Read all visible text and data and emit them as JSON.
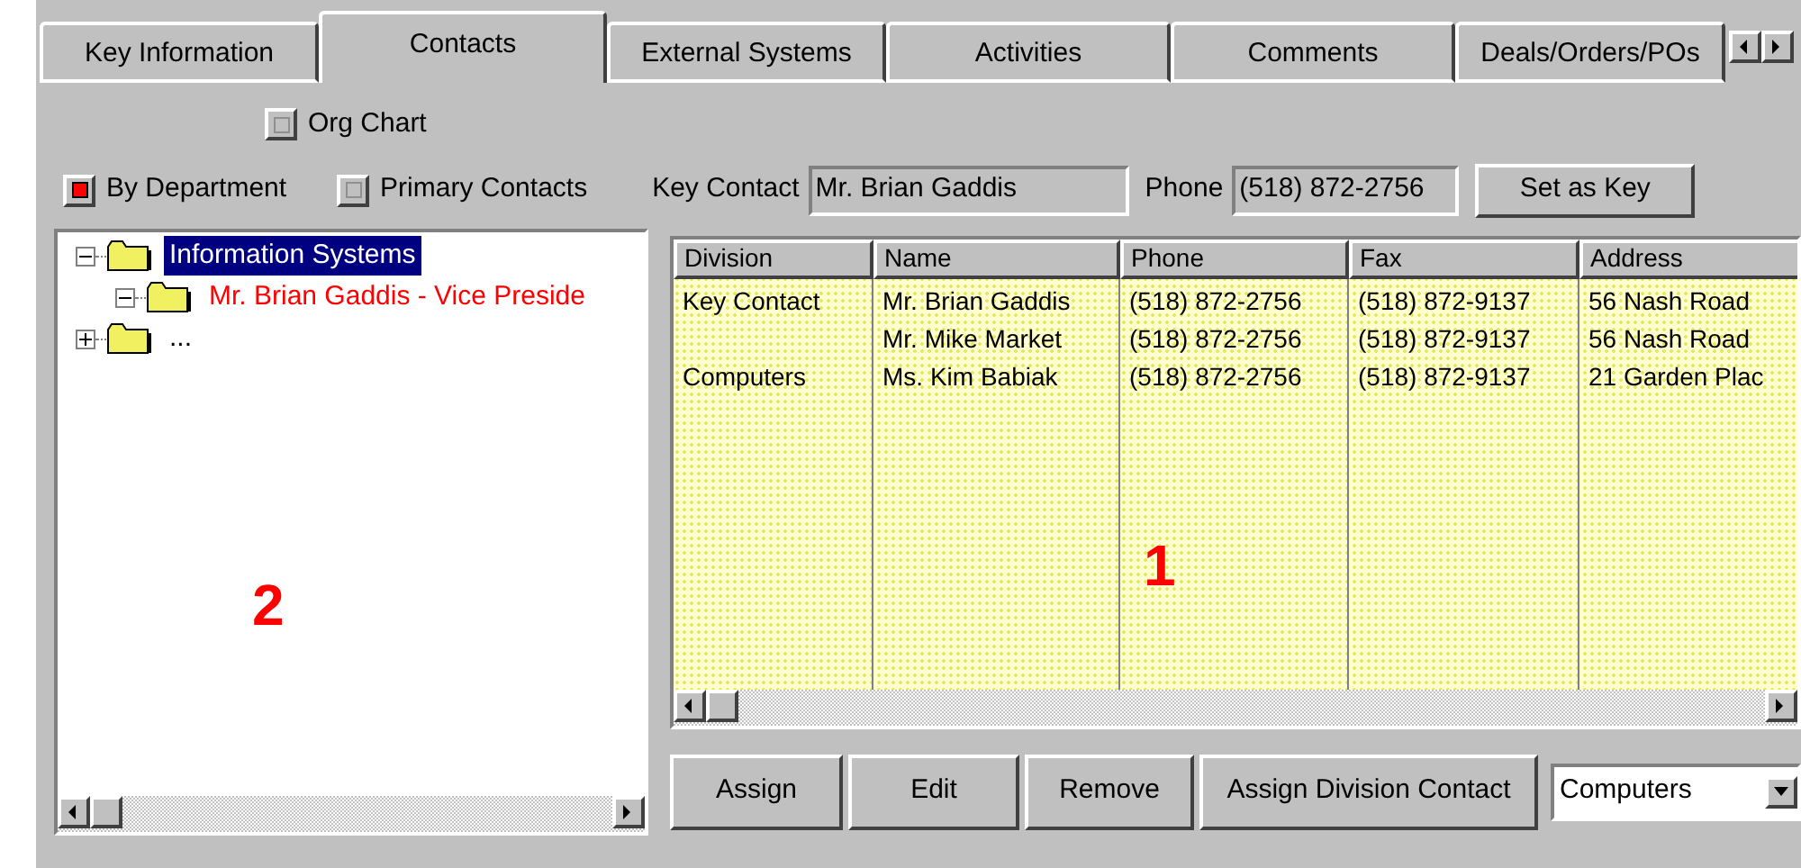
{
  "tabs": [
    {
      "label": "Key Information",
      "selected": false
    },
    {
      "label": "Contacts",
      "selected": true
    },
    {
      "label": "External Systems",
      "selected": false
    },
    {
      "label": "Activities",
      "selected": false
    },
    {
      "label": "Comments",
      "selected": false
    },
    {
      "label": "Deals/Orders/POs",
      "selected": false
    }
  ],
  "options": [
    {
      "label": "Org Chart",
      "checked": false
    },
    {
      "label": "By Department",
      "checked": true
    },
    {
      "label": "Primary Contacts",
      "checked": false
    }
  ],
  "key_contact": {
    "label": "Key Contact",
    "value": "Mr. Brian Gaddis"
  },
  "phone": {
    "label": "Phone",
    "value": "(518) 872-2756"
  },
  "set_as_key": "Set as Key",
  "tree": [
    {
      "label": "Information Systems",
      "selected": true,
      "expanded": true,
      "children": [
        {
          "label": "Mr. Brian Gaddis - Vice Preside",
          "selected": false,
          "expanded": true,
          "color": "#ff0000"
        }
      ]
    },
    {
      "label": "...",
      "selected": false,
      "expanded": false,
      "color": "#000000"
    }
  ],
  "table": {
    "columns": [
      "Division",
      "Name",
      "Phone",
      "Fax",
      "Address"
    ],
    "rows": [
      [
        "Key Contact",
        "Mr. Brian Gaddis",
        "(518) 872-2756",
        "(518) 872-9137",
        "56 Nash Road"
      ],
      [
        "",
        "Mr. Mike Market",
        "(518) 872-2756",
        "(518) 872-9137",
        "56 Nash Road"
      ],
      [
        "Computers",
        "Ms. Kim Babiak",
        "(518) 872-2756",
        "(518) 872-9137",
        "21 Garden Plac"
      ]
    ]
  },
  "buttons": [
    "Assign",
    "Edit",
    "Remove",
    "Assign Division Contact"
  ],
  "division_select": {
    "value": "Computers"
  },
  "annotations": [
    "1",
    "2"
  ]
}
